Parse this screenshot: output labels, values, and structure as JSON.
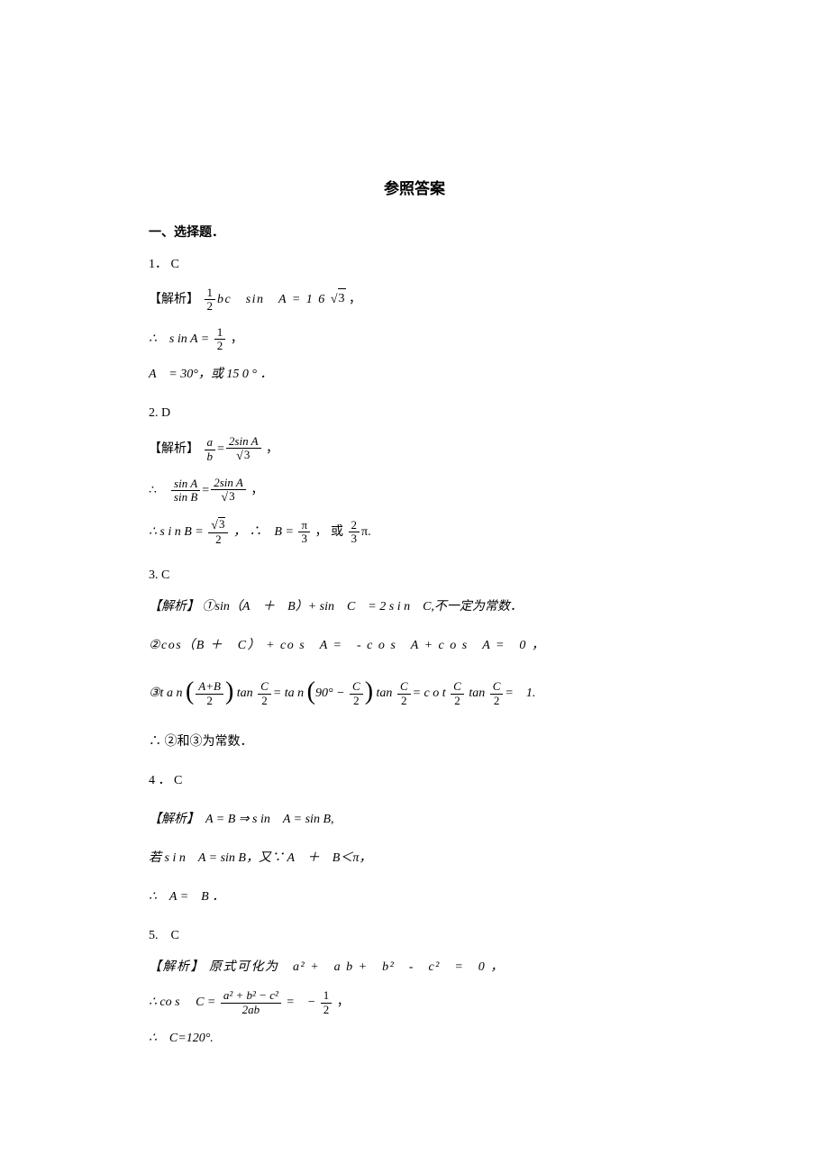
{
  "title": "参照答案",
  "section_heading": "一、选择题．",
  "q1": {
    "num": "1． C",
    "analysis_label": "【解析】",
    "eq1_prefix": "",
    "eq1_frac_num": "1",
    "eq1_frac_den": "2",
    "eq1_mid": "bc　sin　A = 1 6 ",
    "eq1_sqrt": "3",
    "eq1_suffix": " ，",
    "eq2_prefix": "∴　s in A  = ",
    "eq2_frac_num": "1",
    "eq2_frac_den": "2",
    "eq2_suffix": " ，",
    "eq3": "A　= 30°，或 15 0 ° ．"
  },
  "q2": {
    "num": "2. D",
    "analysis_label": "【解析】 ",
    "eq1_frac1_num": "a",
    "eq1_frac1_den": "b",
    "eq1_equals": "=",
    "eq1_frac2_num": "2sin A",
    "eq1_frac2_den_sqrt": "3",
    "eq1_suffix": " ，",
    "eq2_prefix": "∴　",
    "eq2_frac1_num": "sin A",
    "eq2_frac1_den": "sin B",
    "eq2_equals": "=",
    "eq2_frac2_num": "2sin A",
    "eq2_frac2_den_sqrt": "3",
    "eq2_suffix": "  ，",
    "eq3_prefix": "∴  s i n B = ",
    "eq3_frac1_num_sqrt": "3",
    "eq3_frac1_den": "2",
    "eq3_mid": " ，  ∴　B = ",
    "eq3_frac2_num": "π",
    "eq3_frac2_den": "3",
    "eq3_mid2": " ， 或 ",
    "eq3_frac3_num": "2",
    "eq3_frac3_den": "3",
    "eq3_suffix": "π."
  },
  "q3": {
    "num": "3. C",
    "line1": "【解析】 ①sin（A　＋　B）+ sin　C　= 2 s i n　C,不一定为常数．",
    "line2": "②cos（B ＋　C） + co s　A =　- c o s　A + c o s　A =　0 ，",
    "line3_prefix": "③t a  n ",
    "line3_frac1_num": "A+B",
    "line3_frac1_den": "2",
    "line3_mid1": " tan ",
    "line3_frac2_num": "C",
    "line3_frac2_den": "2",
    "line3_eq1": "= ta n ",
    "line3_paren_inner_pre": "90° − ",
    "line3_frac3_num": "C",
    "line3_frac3_den": "2",
    "line3_mid2": " tan ",
    "line3_frac4_num": "C",
    "line3_frac4_den": "2",
    "line3_eq2": "= c o t ",
    "line3_frac5_num": "C",
    "line3_frac5_den": "2",
    "line3_mid3": " tan ",
    "line3_frac6_num": "C",
    "line3_frac6_den": "2",
    "line3_suffix": "=　1.",
    "line4": "∴  ②和③为常数．"
  },
  "q4": {
    "num": "4 ． C",
    "line1": "【解析】　A = B ⇒  s in　A = sin B,",
    "line2": "若 s i n　A = sin B，又∵ A　＋　B＜π，",
    "line3": "∴　A =　B ．"
  },
  "q5": {
    "num": "5.　C",
    "line1": "【解析】 原式可化为　a² +　a  b +　b²　-　c²　=　0 ，",
    "line2_prefix": "∴  co s　 C = ",
    "line2_frac_num": "a² + b² − c²",
    "line2_frac_den": "2ab",
    "line2_mid": " =　− ",
    "line2_frac2_num": "1",
    "line2_frac2_den": "2",
    "line2_suffix": " ，",
    "line3": "∴　C=120°."
  }
}
